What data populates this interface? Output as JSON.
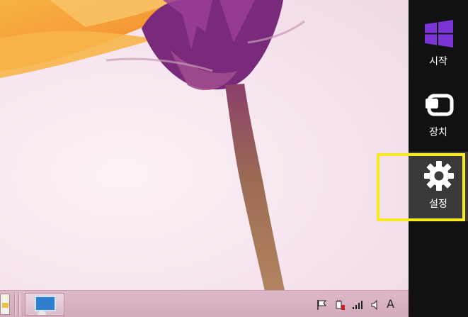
{
  "charms": {
    "items": [
      {
        "label": "시작",
        "icon": "windows-start-icon"
      },
      {
        "label": "장치",
        "icon": "devices-icon"
      },
      {
        "label": "설정",
        "icon": "gear-icon"
      }
    ],
    "selected": "설정",
    "highlight_color": "#f7ec22",
    "background_color": "#111111"
  },
  "taskbar": {
    "pinned": [
      "file-explorer-icon",
      "server-manager-icon"
    ],
    "tray": {
      "icons": [
        "action-center-flag-icon",
        "network-cable-icon",
        "signal-icon",
        "volume-icon"
      ],
      "ime_indicator": "A"
    }
  },
  "colors": {
    "start_tile": "#7b34d6",
    "wallpaper_flower": "#f29a2a"
  }
}
